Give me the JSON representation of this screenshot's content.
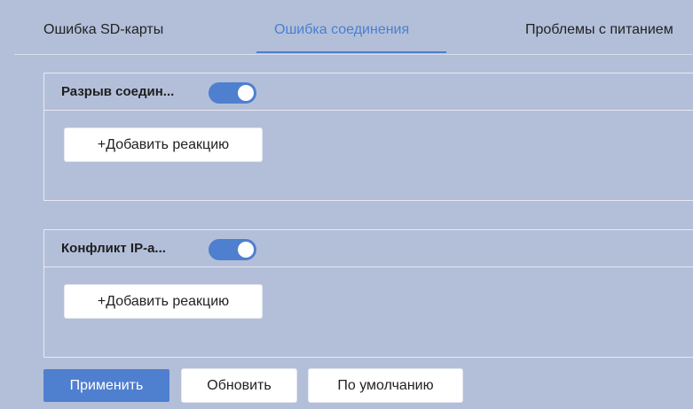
{
  "tabs": [
    {
      "label": "Ошибка SD-карты",
      "active": false
    },
    {
      "label": "Ошибка соединения",
      "active": true
    },
    {
      "label": "Проблемы с питанием",
      "active": false
    }
  ],
  "panels": [
    {
      "title": "Разрыв соедин...",
      "enabled": true,
      "add_reaction_label": "+Добавить реакцию"
    },
    {
      "title": "Конфликт IP-а...",
      "enabled": true,
      "add_reaction_label": "+Добавить реакцию"
    }
  ],
  "footer": {
    "apply_label": "Применить",
    "refresh_label": "Обновить",
    "default_label": "По умолчанию"
  },
  "colors": {
    "background": "#b3bfd9",
    "accent": "#4f7fcf",
    "active_tab": "#4a7fd0"
  }
}
